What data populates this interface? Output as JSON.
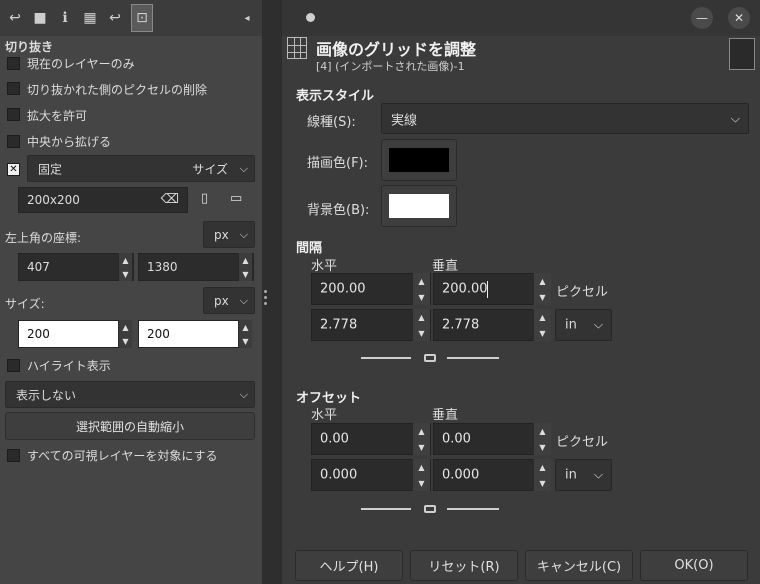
{
  "tool_options": {
    "title": "切り抜き",
    "checkboxes": [
      {
        "label": "現在のレイヤーのみ",
        "checked": false
      },
      {
        "label": "切り抜かれた側のピクセルの削除",
        "checked": false
      },
      {
        "label": "拡大を許可",
        "checked": false
      },
      {
        "label": "中央から拡げる",
        "checked": false
      }
    ],
    "fixed_label": "固定",
    "fixed_checked": true,
    "fixed_mode": "サイズ",
    "fixed_value": "200x200",
    "position_label": "左上角の座標:",
    "position_unit": "px",
    "position_x": "407",
    "position_y": "1380",
    "size_label": "サイズ:",
    "size_unit": "px",
    "size_w": "200",
    "size_h": "200",
    "highlight_label": "ハイライト表示",
    "guides_value": "表示しない",
    "auto_shrink_label": "選択範囲の自動縮小",
    "all_visible_label": "すべての可視レイヤーを対象にする"
  },
  "dialog": {
    "title": "画像のグリッドを調整",
    "subtitle": "[4] (インポートされた画像)-1",
    "appearance_section": "表示スタイル",
    "line_style_label": "線種(S):",
    "line_style_value": "実線",
    "fg_color_label": "描画色(F):",
    "bg_color_label": "背景色(B):",
    "fg_color": "#000000",
    "bg_color": "#ffffff",
    "spacing_section": "間隔",
    "horizontal_label": "水平",
    "vertical_label": "垂直",
    "spacing_h_px": "200.00",
    "spacing_v_px": "200.00",
    "spacing_unit_px": "ピクセル",
    "spacing_h_in": "2.778",
    "spacing_v_in": "2.778",
    "spacing_unit_in": "in",
    "offset_section": "オフセット",
    "offset_h_px": "0.00",
    "offset_v_px": "0.00",
    "offset_unit_px": "ピクセル",
    "offset_h_in": "0.000",
    "offset_v_in": "0.000",
    "offset_unit_in": "in",
    "buttons": {
      "help": "ヘルプ(H)",
      "reset": "リセット(R)",
      "cancel": "キャンセル(C)",
      "ok": "OK(O)"
    }
  }
}
